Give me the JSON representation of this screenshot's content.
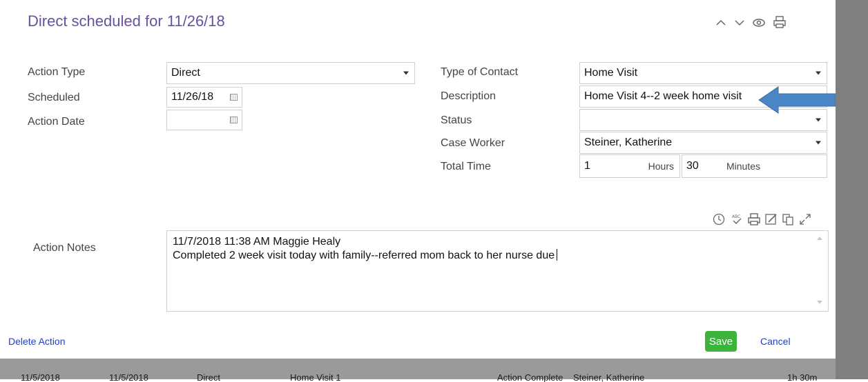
{
  "header": {
    "title": "Direct scheduled for 11/26/18",
    "icons": [
      "chevron-up-icon",
      "chevron-down-icon",
      "eye-icon",
      "print-icon"
    ]
  },
  "form": {
    "action_type": {
      "label": "Action Type",
      "value": "Direct"
    },
    "scheduled": {
      "label": "Scheduled",
      "value": "11/26/18"
    },
    "action_date": {
      "label": "Action Date",
      "value": ""
    },
    "type_of_contact": {
      "label": "Type of Contact",
      "value": "Home Visit"
    },
    "description": {
      "label": "Description",
      "value": "Home Visit 4--2 week home visit"
    },
    "status": {
      "label": "Status",
      "value": ""
    },
    "case_worker": {
      "label": "Case Worker",
      "value": "Steiner, Katherine"
    },
    "total_time": {
      "label": "Total Time",
      "hours_value": "1",
      "hours_label": "Hours",
      "minutes_value": "30",
      "minutes_label": "Minutes"
    }
  },
  "notes": {
    "label": "Action Notes",
    "toolbar_icons": [
      "clock-icon",
      "spellcheck-icon",
      "print-icon",
      "edit-icon",
      "copy-icon",
      "expand-icon"
    ],
    "lines": [
      "11/7/2018 11:38 AM   Maggie Healy",
      "Completed 2 week visit today with family--referred mom back to her nurse due"
    ]
  },
  "footer": {
    "delete_label": "Delete Action",
    "save_label": "Save",
    "cancel_label": "Cancel"
  },
  "background_row": {
    "cells": [
      "11/5/2018",
      "11/5/2018",
      "Direct",
      "Home Visit 1",
      "Action Complete",
      "Steiner, Katherine",
      "1h 30m"
    ]
  },
  "colors": {
    "title": "#6a4fa3",
    "save_button": "#3cb43c",
    "link": "#1a3ecf",
    "arrow": "#4a86c5"
  }
}
